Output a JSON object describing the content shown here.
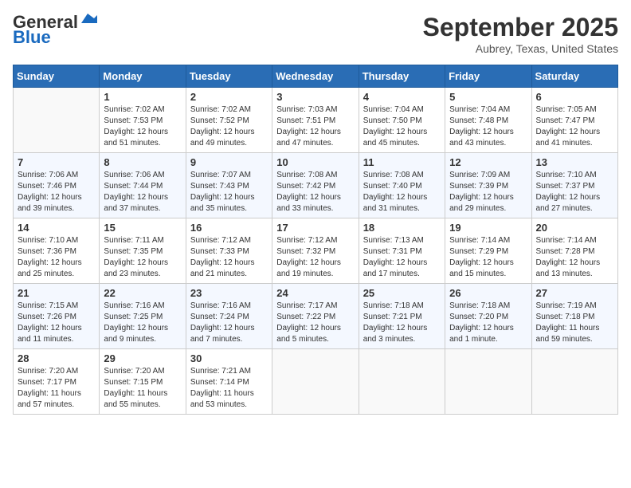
{
  "header": {
    "logo_line1": "General",
    "logo_line2": "Blue",
    "month": "September 2025",
    "location": "Aubrey, Texas, United States"
  },
  "days_of_week": [
    "Sunday",
    "Monday",
    "Tuesday",
    "Wednesday",
    "Thursday",
    "Friday",
    "Saturday"
  ],
  "weeks": [
    [
      {
        "day": "",
        "info": ""
      },
      {
        "day": "1",
        "info": "Sunrise: 7:02 AM\nSunset: 7:53 PM\nDaylight: 12 hours\nand 51 minutes."
      },
      {
        "day": "2",
        "info": "Sunrise: 7:02 AM\nSunset: 7:52 PM\nDaylight: 12 hours\nand 49 minutes."
      },
      {
        "day": "3",
        "info": "Sunrise: 7:03 AM\nSunset: 7:51 PM\nDaylight: 12 hours\nand 47 minutes."
      },
      {
        "day": "4",
        "info": "Sunrise: 7:04 AM\nSunset: 7:50 PM\nDaylight: 12 hours\nand 45 minutes."
      },
      {
        "day": "5",
        "info": "Sunrise: 7:04 AM\nSunset: 7:48 PM\nDaylight: 12 hours\nand 43 minutes."
      },
      {
        "day": "6",
        "info": "Sunrise: 7:05 AM\nSunset: 7:47 PM\nDaylight: 12 hours\nand 41 minutes."
      }
    ],
    [
      {
        "day": "7",
        "info": "Sunrise: 7:06 AM\nSunset: 7:46 PM\nDaylight: 12 hours\nand 39 minutes."
      },
      {
        "day": "8",
        "info": "Sunrise: 7:06 AM\nSunset: 7:44 PM\nDaylight: 12 hours\nand 37 minutes."
      },
      {
        "day": "9",
        "info": "Sunrise: 7:07 AM\nSunset: 7:43 PM\nDaylight: 12 hours\nand 35 minutes."
      },
      {
        "day": "10",
        "info": "Sunrise: 7:08 AM\nSunset: 7:42 PM\nDaylight: 12 hours\nand 33 minutes."
      },
      {
        "day": "11",
        "info": "Sunrise: 7:08 AM\nSunset: 7:40 PM\nDaylight: 12 hours\nand 31 minutes."
      },
      {
        "day": "12",
        "info": "Sunrise: 7:09 AM\nSunset: 7:39 PM\nDaylight: 12 hours\nand 29 minutes."
      },
      {
        "day": "13",
        "info": "Sunrise: 7:10 AM\nSunset: 7:37 PM\nDaylight: 12 hours\nand 27 minutes."
      }
    ],
    [
      {
        "day": "14",
        "info": "Sunrise: 7:10 AM\nSunset: 7:36 PM\nDaylight: 12 hours\nand 25 minutes."
      },
      {
        "day": "15",
        "info": "Sunrise: 7:11 AM\nSunset: 7:35 PM\nDaylight: 12 hours\nand 23 minutes."
      },
      {
        "day": "16",
        "info": "Sunrise: 7:12 AM\nSunset: 7:33 PM\nDaylight: 12 hours\nand 21 minutes."
      },
      {
        "day": "17",
        "info": "Sunrise: 7:12 AM\nSunset: 7:32 PM\nDaylight: 12 hours\nand 19 minutes."
      },
      {
        "day": "18",
        "info": "Sunrise: 7:13 AM\nSunset: 7:31 PM\nDaylight: 12 hours\nand 17 minutes."
      },
      {
        "day": "19",
        "info": "Sunrise: 7:14 AM\nSunset: 7:29 PM\nDaylight: 12 hours\nand 15 minutes."
      },
      {
        "day": "20",
        "info": "Sunrise: 7:14 AM\nSunset: 7:28 PM\nDaylight: 12 hours\nand 13 minutes."
      }
    ],
    [
      {
        "day": "21",
        "info": "Sunrise: 7:15 AM\nSunset: 7:26 PM\nDaylight: 12 hours\nand 11 minutes."
      },
      {
        "day": "22",
        "info": "Sunrise: 7:16 AM\nSunset: 7:25 PM\nDaylight: 12 hours\nand 9 minutes."
      },
      {
        "day": "23",
        "info": "Sunrise: 7:16 AM\nSunset: 7:24 PM\nDaylight: 12 hours\nand 7 minutes."
      },
      {
        "day": "24",
        "info": "Sunrise: 7:17 AM\nSunset: 7:22 PM\nDaylight: 12 hours\nand 5 minutes."
      },
      {
        "day": "25",
        "info": "Sunrise: 7:18 AM\nSunset: 7:21 PM\nDaylight: 12 hours\nand 3 minutes."
      },
      {
        "day": "26",
        "info": "Sunrise: 7:18 AM\nSunset: 7:20 PM\nDaylight: 12 hours\nand 1 minute."
      },
      {
        "day": "27",
        "info": "Sunrise: 7:19 AM\nSunset: 7:18 PM\nDaylight: 11 hours\nand 59 minutes."
      }
    ],
    [
      {
        "day": "28",
        "info": "Sunrise: 7:20 AM\nSunset: 7:17 PM\nDaylight: 11 hours\nand 57 minutes."
      },
      {
        "day": "29",
        "info": "Sunrise: 7:20 AM\nSunset: 7:15 PM\nDaylight: 11 hours\nand 55 minutes."
      },
      {
        "day": "30",
        "info": "Sunrise: 7:21 AM\nSunset: 7:14 PM\nDaylight: 11 hours\nand 53 minutes."
      },
      {
        "day": "",
        "info": ""
      },
      {
        "day": "",
        "info": ""
      },
      {
        "day": "",
        "info": ""
      },
      {
        "day": "",
        "info": ""
      }
    ]
  ]
}
